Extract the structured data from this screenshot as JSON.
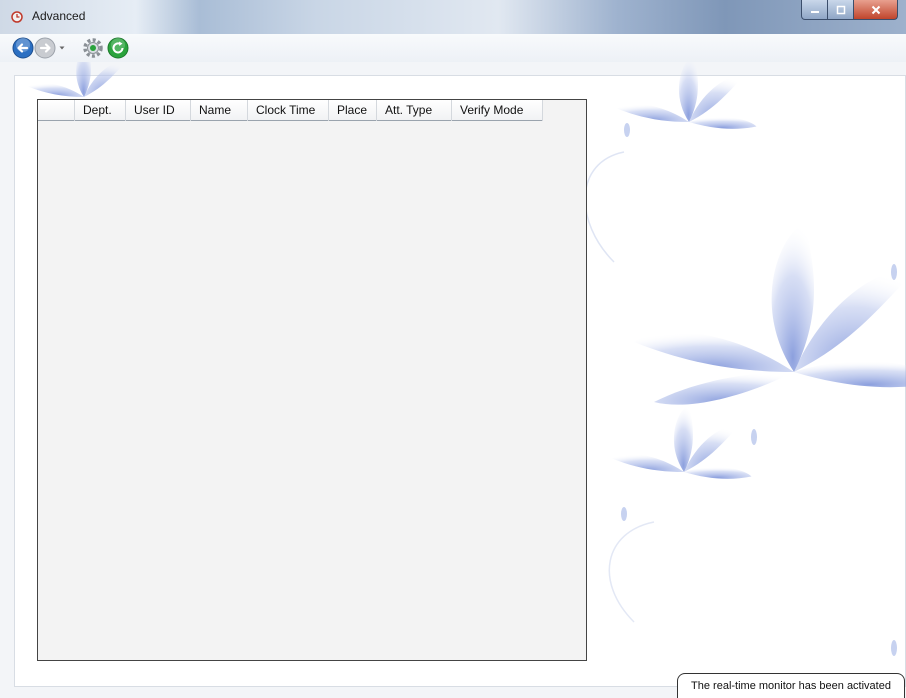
{
  "window": {
    "title": "Advanced",
    "icon": "app-clock-icon",
    "controls": {
      "minimize": "minimize-icon",
      "maximize": "maximize-icon",
      "close": "close-icon"
    }
  },
  "toolbar": {
    "back": "back-arrow-icon",
    "forward": "forward-arrow-icon",
    "history_dropdown": "chevron-down-icon",
    "settings": "gear-icon",
    "refresh": "refresh-icon"
  },
  "grid": {
    "columns": [
      "",
      "Dept.",
      "User ID",
      "Name",
      "Clock Time",
      "Place",
      "Att. Type",
      "Verify Mode"
    ],
    "rows": []
  },
  "status": {
    "message": "The real-time monitor has been activated"
  },
  "colors": {
    "accent": "#2b6fc2",
    "refresh_green": "#2aa33c",
    "close_red": "#c0452c",
    "flower_blue": "#aab9e6"
  }
}
